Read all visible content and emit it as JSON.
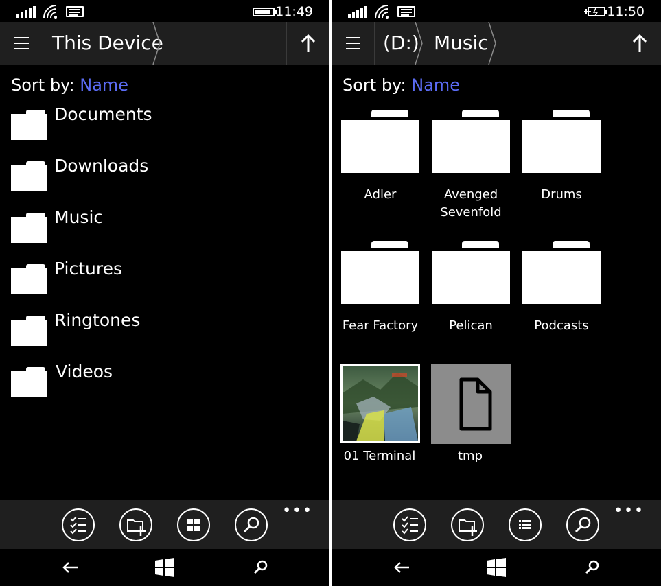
{
  "left": {
    "status": {
      "time": "11:49"
    },
    "breadcrumb": [
      "This Device"
    ],
    "sort": {
      "label": "Sort by:",
      "value": "Name"
    },
    "items": [
      {
        "label": "Documents"
      },
      {
        "label": "Downloads"
      },
      {
        "label": "Music"
      },
      {
        "label": "Pictures"
      },
      {
        "label": "Ringtones"
      },
      {
        "label": "Videos"
      }
    ],
    "appbar": {
      "buttons": [
        "select-icon",
        "new-folder-icon",
        "grid-view-icon",
        "search-icon"
      ],
      "more": "•••"
    }
  },
  "right": {
    "status": {
      "time": "11:50"
    },
    "breadcrumb": [
      "(D:)",
      "Music"
    ],
    "sort": {
      "label": "Sort by:",
      "value": "Name"
    },
    "folders": [
      {
        "label": "Adler"
      },
      {
        "label": "Avenged Sevenfold"
      },
      {
        "label": "Drums"
      },
      {
        "label": "Fear Factory"
      },
      {
        "label": "Pelican"
      },
      {
        "label": "Podcasts"
      }
    ],
    "files": [
      {
        "label": "01 Terminal",
        "kind": "album-art"
      },
      {
        "label": "tmp",
        "kind": "document"
      }
    ],
    "appbar": {
      "buttons": [
        "select-icon",
        "new-folder-icon",
        "list-view-icon",
        "search-icon"
      ],
      "more": "•••"
    }
  },
  "colors": {
    "accent": "#5b6cf5",
    "bar": "#1f1f1f",
    "background": "#000000",
    "file_tile": "#8c8c8c"
  },
  "nav": [
    "back-icon",
    "windows-start-icon",
    "search-icon"
  ]
}
